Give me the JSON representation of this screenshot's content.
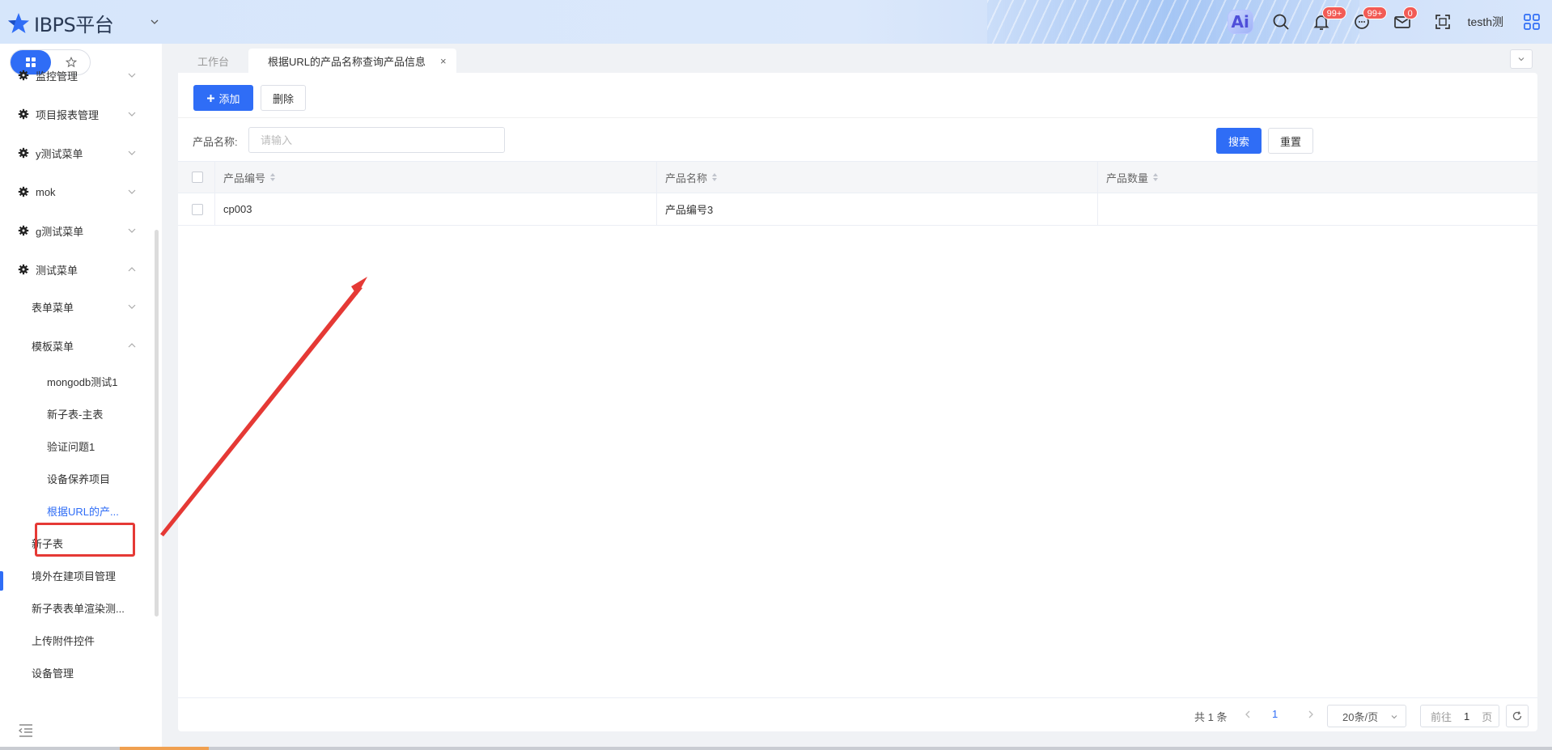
{
  "header": {
    "title": "IBPS平台",
    "ai_label": "Ai",
    "notifications_badge": "99+",
    "messages_badge": "99+",
    "mail_badge": "0",
    "user_name": "testh测",
    "icons": [
      "search-icon",
      "bell-icon",
      "chat-icon",
      "mail-icon",
      "fullscreen-icon",
      "apps-grid-icon"
    ]
  },
  "sidebar": {
    "menu": [
      {
        "label": "监控管理",
        "level": 1,
        "expanded": false
      },
      {
        "label": "项目报表管理",
        "level": 1,
        "expanded": false
      },
      {
        "label": "y测试菜单",
        "level": 1,
        "expanded": false
      },
      {
        "label": "mok",
        "level": 1,
        "expanded": false
      },
      {
        "label": "g测试菜单",
        "level": 1,
        "expanded": false
      },
      {
        "label": "测试菜单",
        "level": 1,
        "expanded": true
      },
      {
        "label": "表单菜单",
        "level": 2,
        "expanded": false
      },
      {
        "label": "模板菜单",
        "level": 2,
        "expanded": true
      },
      {
        "label": "mongodb测试1",
        "level": 3
      },
      {
        "label": "新子表-主表",
        "level": 3
      },
      {
        "label": "验证问题1",
        "level": 3
      },
      {
        "label": "设备保养项目",
        "level": 3
      },
      {
        "label": "根据URL的产...",
        "level": 3,
        "active": true
      },
      {
        "label": "新子表",
        "level": 2
      },
      {
        "label": "境外在建项目管理",
        "level": 2
      },
      {
        "label": "新子表表单渲染测...",
        "level": 2
      },
      {
        "label": "上传附件控件",
        "level": 2
      },
      {
        "label": "设备管理",
        "level": 2
      }
    ]
  },
  "tabs": [
    {
      "label": "工作台",
      "active": false
    },
    {
      "label": "根据URL的产品名称查询产品信息",
      "active": true,
      "close": "×"
    }
  ],
  "toolbar": {
    "add_label": "添加",
    "delete_label": "删除"
  },
  "search": {
    "label": "产品名称:",
    "placeholder": "请输入",
    "value": "",
    "search_label": "搜索",
    "reset_label": "重置"
  },
  "table": {
    "columns": [
      "产品编号",
      "产品名称",
      "产品数量"
    ],
    "rows": [
      [
        "cp003",
        "产品编号3",
        ""
      ]
    ]
  },
  "pagination": {
    "total_text": "共 1 条",
    "current_page": "1",
    "page_size": "20条/页",
    "goto_prefix": "前往",
    "goto_value": "1",
    "goto_suffix": "页"
  },
  "colors": {
    "primary": "#2f6df6",
    "annotation_red": "#e53935",
    "badge_red": "#f25b55"
  }
}
